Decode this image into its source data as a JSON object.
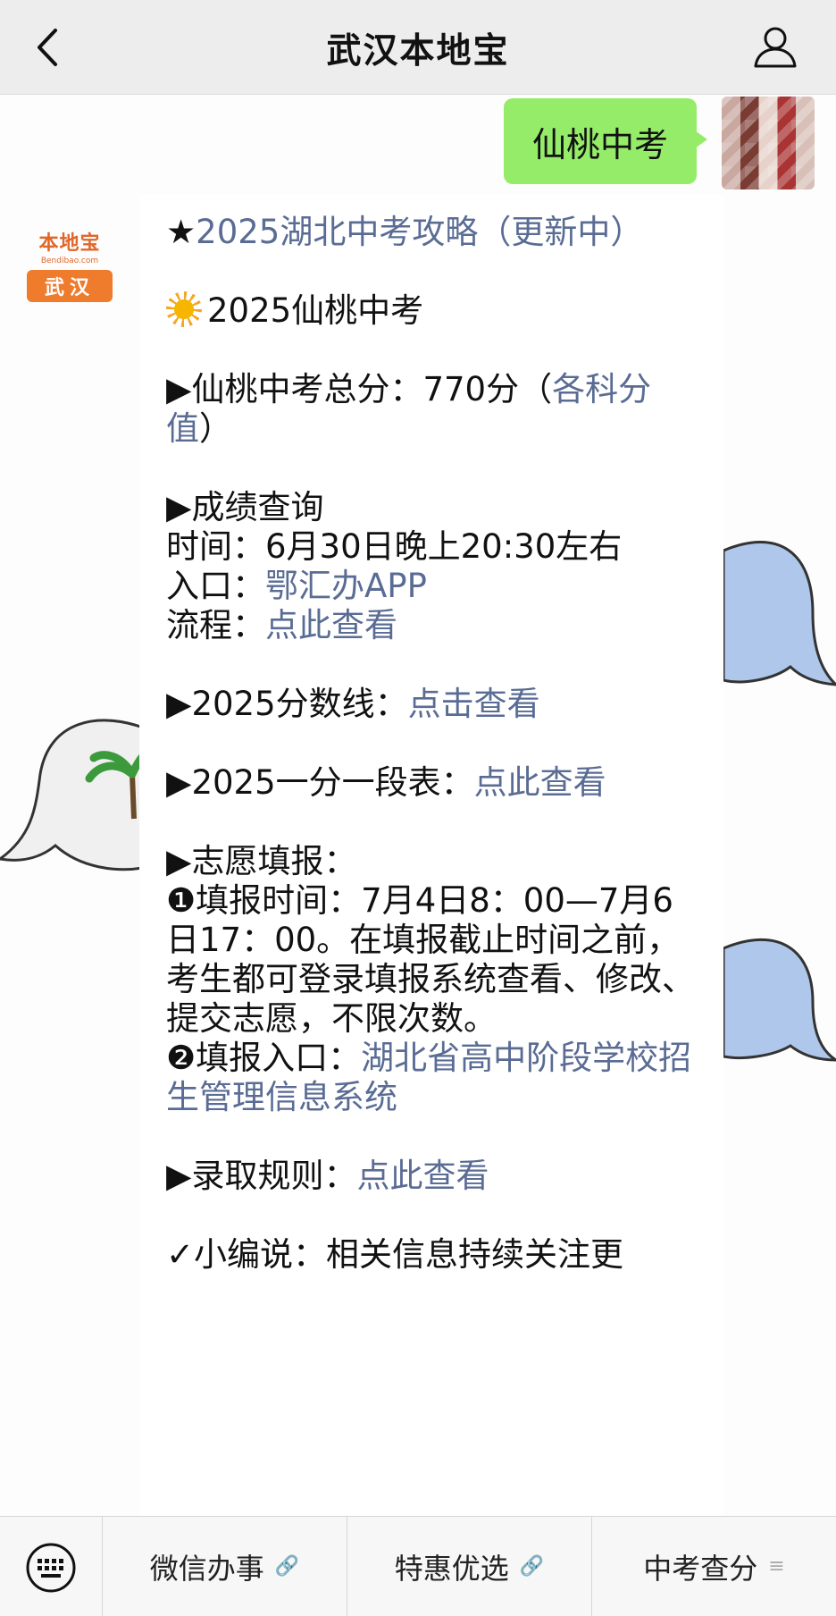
{
  "header": {
    "title": "武汉本地宝",
    "back_icon": "chevron-left-icon",
    "profile_icon": "user-icon"
  },
  "chat": {
    "user_message": "仙桃中考",
    "bot": {
      "logo_top": "本地宝",
      "logo_sub": "Bendibao.com",
      "logo_city": "武汉"
    },
    "card": {
      "l1_star": "★",
      "l1_link": "2025湖北中考攻略（更新中）",
      "l2_text": "2025仙桃中考",
      "l3_text": "▶仙桃中考总分：770分（",
      "l3_link": "各科分值",
      "l3_close": "）",
      "l4_head": "▶成绩查询",
      "l4_time": "时间：6月30日晚上20:30左右",
      "l4_entry_label": "入口：",
      "l4_entry_link": "鄂汇办APP",
      "l4_flow_label": "流程：",
      "l4_flow_link": "点此查看",
      "l5_label": "▶2025分数线：",
      "l5_link": "点击查看",
      "l6_label": "▶2025一分一段表：",
      "l6_link": "点此查看",
      "l7_head": "▶志愿填报：",
      "l7_item1": "❶填报时间：7月4日8：00—7月6日17：00。在填报截止时间之前，考生都可登录填报系统查看、修改、提交志愿，不限次数。",
      "l7_item2_label": "❷填报入口：",
      "l7_item2_link": "湖北省高中阶段学校招生管理信息系统",
      "l8_label": "▶录取规则：",
      "l8_link": "点此查看",
      "l9_partial": "✓小编说：相关信息持续关注更"
    }
  },
  "menu": {
    "keyboard_icon": "keyboard-icon",
    "items": [
      {
        "label": "微信办事",
        "icon": "link-icon"
      },
      {
        "label": "特惠优选",
        "icon": "link-icon"
      },
      {
        "label": "中考查分",
        "icon": "menu-lines-icon"
      }
    ]
  },
  "colors": {
    "bubble_green": "#95ec69",
    "link_blue": "#5a6c94",
    "brand_orange": "#ef7b2d"
  }
}
